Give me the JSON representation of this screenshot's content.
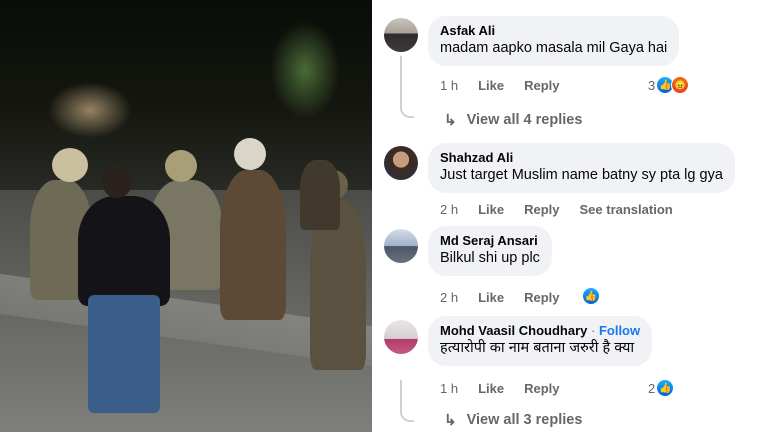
{
  "photo": {
    "alt_icon": "police-scene-photo"
  },
  "comments": [
    {
      "author": "Asfak Ali",
      "text": "madam aapko masala mil Gaya hai",
      "time": "1 h",
      "like": "Like",
      "reply": "Reply",
      "reaction_count": "3",
      "reactions": [
        "like-icon",
        "angry-icon"
      ],
      "view_replies": "View all 4 replies"
    },
    {
      "author": "Shahzad Ali",
      "text": "Just target Muslim name batny sy pta lg gya",
      "time": "2 h",
      "like": "Like",
      "reply": "Reply",
      "see_translation": "See translation"
    },
    {
      "author": "Md Seraj Ansari",
      "text": "Bilkul shi up plc",
      "time": "2 h",
      "like": "Like",
      "reply": "Reply",
      "reactions": [
        "like-icon"
      ]
    },
    {
      "author": "Mohd Vaasil Choudhary",
      "follow": "Follow",
      "separator": "·",
      "text": "हत्यारोपी का नाम बताना जरुरी है क्या",
      "time": "1 h",
      "like": "Like",
      "reply": "Reply",
      "reaction_count": "2",
      "reactions": [
        "like-icon"
      ],
      "view_replies": "View all 3 replies"
    }
  ],
  "colors": {
    "link_blue": "#1877f2",
    "bubble_bg": "#f0f2f5",
    "muted_text": "#65676b"
  }
}
